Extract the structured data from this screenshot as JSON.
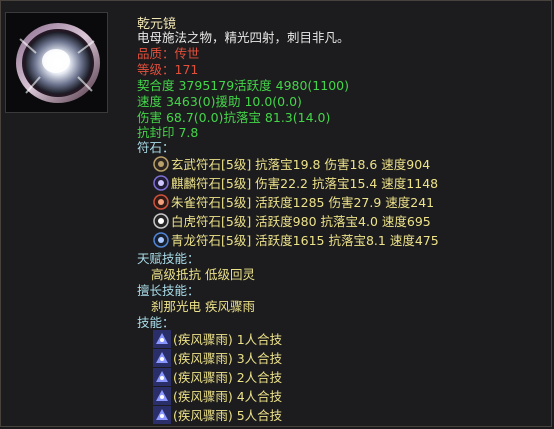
{
  "item": {
    "name": "乾元镜",
    "description": "电母施法之物，精光四射，刺目非凡。",
    "quality": "品质：传世",
    "level": "等级：171",
    "stats": {
      "row1": "契合度    3795179活跃度  4980(1100)",
      "row2": "速度      3463(0)援助    10.0(0.0)",
      "row3": "伤害      68.7(0.0)抗落宝  81.3(14.0)",
      "row4": "抗封印 7.8"
    }
  },
  "runes": {
    "header": "符石：",
    "items": [
      {
        "text": "玄武符石[5级] 抗落宝19.8 伤害18.6 速度904",
        "icon": "xuanwu-rune-icon",
        "color": "#b9a16a"
      },
      {
        "text": "麒麟符石[5级] 伤害22.2 抗落宝15.4 速度1148",
        "icon": "qilin-rune-icon",
        "color": "#7d6fd6"
      },
      {
        "text": "朱雀符石[5级] 活跃度1285 伤害27.9 速度241",
        "icon": "zhuque-rune-icon",
        "color": "#d0523c"
      },
      {
        "text": "白虎符石[5级] 活跃度980 抗落宝4.0 速度695",
        "icon": "baihu-rune-icon",
        "color": "#c9c9c9"
      },
      {
        "text": "青龙符石[5级] 活跃度1615 抗落宝8.1 速度475",
        "icon": "qinglong-rune-icon",
        "color": "#4f86d6"
      }
    ]
  },
  "talents": {
    "header": "天赋技能：",
    "items": "高级抵抗    低级回灵"
  },
  "specialty": {
    "header": "擅长技能：",
    "items": "刹那光电    疾风骤雨"
  },
  "skills": {
    "header": "技能：",
    "items": [
      {
        "text": "(疾风骤雨) 1人合技",
        "icon": "combo-skill-icon"
      },
      {
        "text": "(疾风骤雨) 3人合技",
        "icon": "combo-skill-icon"
      },
      {
        "text": "(疾风骤雨) 2人合技",
        "icon": "combo-skill-icon"
      },
      {
        "text": "(疾风骤雨) 4人合技",
        "icon": "combo-skill-icon"
      },
      {
        "text": "(疾风骤雨) 5人合技",
        "icon": "combo-skill-icon"
      }
    ]
  }
}
